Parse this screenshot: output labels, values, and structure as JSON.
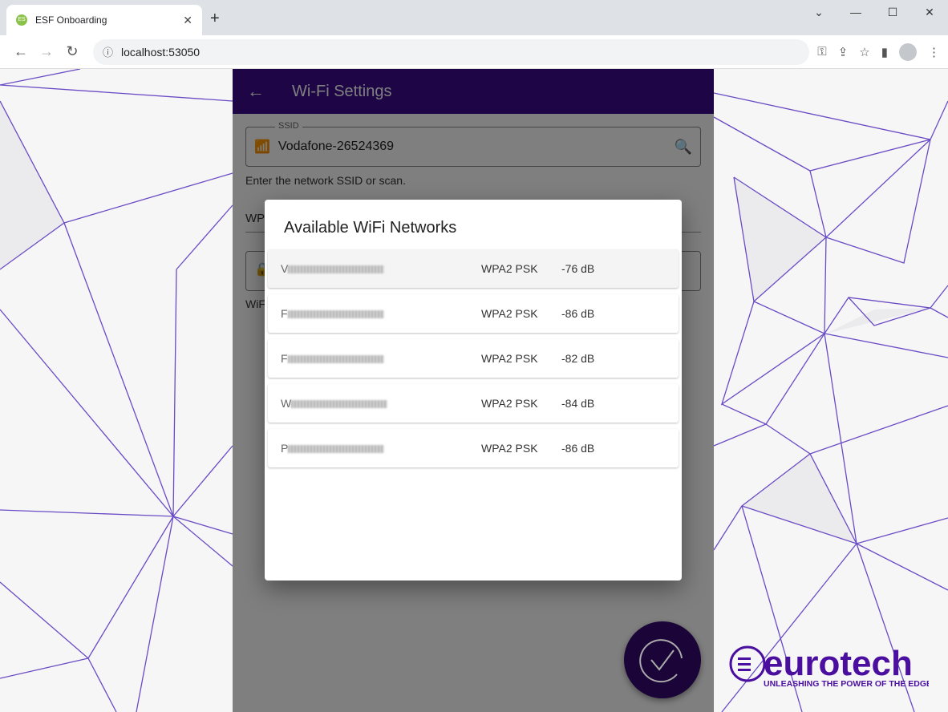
{
  "browser": {
    "tab_title": "ESF Onboarding",
    "url": "localhost:53050",
    "new_tab": "+",
    "close": "✕"
  },
  "app": {
    "title": "Wi-Fi Settings",
    "ssid_label": "SSID",
    "ssid_value": "Vodafone-26524369",
    "ssid_hint": "Enter the network SSID or scan.",
    "wpa_label": "WP",
    "pw_hint": "WiF"
  },
  "dialog": {
    "title": "Available WiFi Networks",
    "networks": [
      {
        "ssid_initial": "V",
        "security": "WPA2 PSK",
        "signal": "-76 dB"
      },
      {
        "ssid_initial": "F",
        "security": "WPA2 PSK",
        "signal": "-86 dB"
      },
      {
        "ssid_initial": "F",
        "security": "WPA2 PSK",
        "signal": "-82 dB"
      },
      {
        "ssid_initial": "W",
        "security": "WPA2 PSK",
        "signal": "-84 dB"
      },
      {
        "ssid_initial": "P",
        "security": "WPA2 PSK",
        "signal": "-86 dB"
      }
    ]
  },
  "logo": {
    "name": "eurotech",
    "tagline": "UNLEASHING THE POWER OF THE EDGE"
  },
  "colors": {
    "brand": "#3a0a8c",
    "logo": "#4b0fa0",
    "lines": "#6a4bc4"
  }
}
